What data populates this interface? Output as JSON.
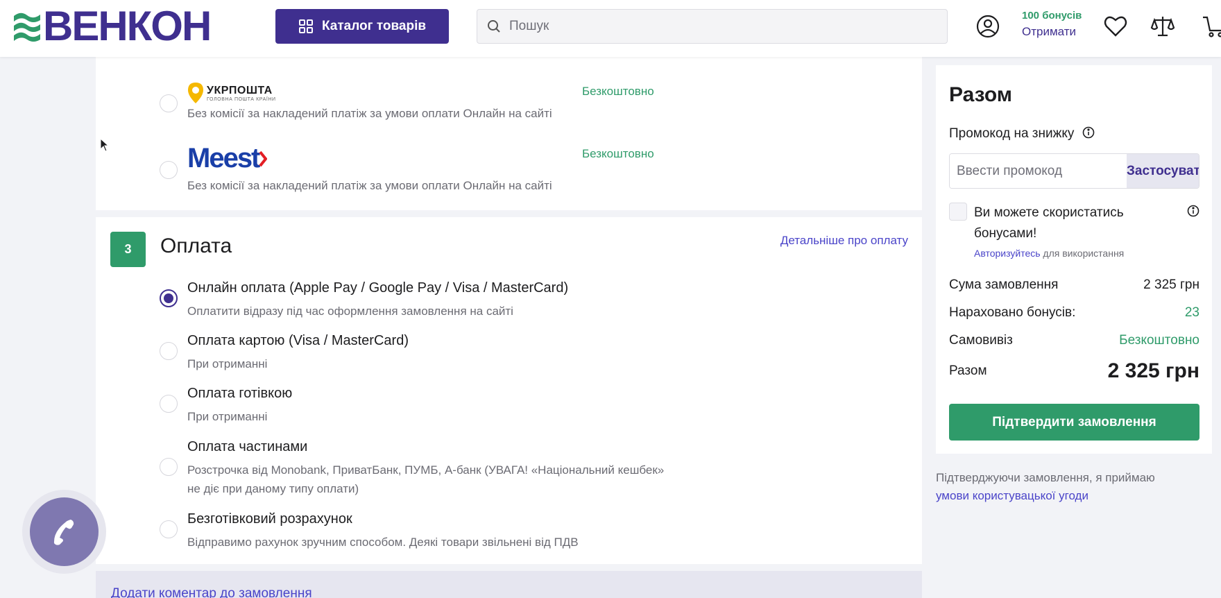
{
  "header": {
    "logo_text": "ВЕНКОН",
    "catalog_label": "Каталог товарів",
    "search_placeholder": "Пошук",
    "bonus_amount": "100 бонусів",
    "bonus_link": "Отримати"
  },
  "delivery": {
    "options": [
      {
        "carrier": "УКРПОШТА",
        "carrier_sub": "ГОЛОВНА ПОШТА КРАЇНИ",
        "price": "Безкоштовно",
        "note": "Без комісії за накладений платіж за умови оплати Онлайн на сайті"
      },
      {
        "carrier": "Meest",
        "price": "Безкоштовно",
        "note": "Без комісії за накладений платіж за умови оплати Онлайн на сайті"
      }
    ]
  },
  "payment": {
    "step": "3",
    "title": "Оплата",
    "details_link": "Детальніше про оплату",
    "options": [
      {
        "title": "Онлайн оплата (Apple Pay / Google Pay / Visa / MasterCard)",
        "sub": "Оплатити відразу під час оформлення замовлення на сайті",
        "selected": true
      },
      {
        "title": "Оплата картою (Visa / MasterCard)",
        "sub": "При отриманні",
        "selected": false
      },
      {
        "title": "Оплата готівкою",
        "sub": "При отриманні",
        "selected": false
      },
      {
        "title": "Оплата частинами",
        "sub": "Розстрочка від Monobank, ПриватБанк, ПУМБ, А-банк (УВАГА! «Національний кешбек»",
        "sub2": "не діє при даному типу оплати)",
        "selected": false
      },
      {
        "title": "Безготівковий розрахунок",
        "sub": "Відправимо рахунок зручним способом. Деякі товари звільнені від ПДВ",
        "selected": false
      }
    ]
  },
  "comment_link": "Додати коментар до замовлення",
  "summary": {
    "title": "Разом",
    "promo_label": "Промокод на знижку",
    "promo_placeholder": "Ввести промокод",
    "apply_label": "Застосувати",
    "bonus_text": "Ви можете скористатись бонусами!",
    "auth_link": "Авторизуйтесь",
    "auth_rest": " для використання",
    "order_sum_label": "Сума замовлення",
    "order_sum_value": "2 325 грн",
    "bonus_earned_label": "Нараховано бонусів:",
    "bonus_earned_value": "23",
    "pickup_label": "Самовивіз",
    "pickup_value": "Безкоштовно",
    "total_label": "Разом",
    "total_value": "2 325 грн",
    "confirm_label": "Підтвердити замовлення"
  },
  "agreement": {
    "text": "Підтверджуючи замовлення, я приймаю",
    "link": "умови користувацької угоди"
  },
  "colors": {
    "brand": "#3f2f8f",
    "accent_green": "#2f9b6a",
    "link": "#4a44c9"
  }
}
